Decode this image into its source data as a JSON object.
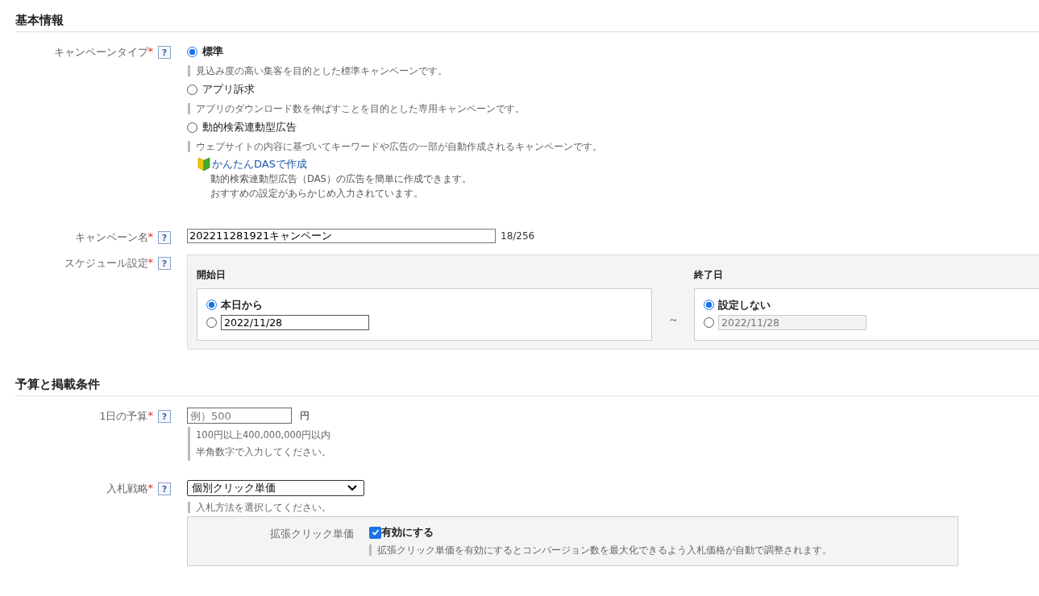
{
  "sections": [
    {
      "title": "基本情報",
      "fields": [
        {
          "kind": "radio_group",
          "label": "キャンペーンタイプ",
          "mark": "*",
          "help": "?",
          "options": [
            {
              "label": "標準",
              "selected": true,
              "hint": "見込み度の高い集客を目的とした標準キャンペーンです。"
            },
            {
              "label": "アプリ訴求",
              "selected": false,
              "hint": "アプリのダウンロード数を伸ばすことを目的とした専用キャンペーンです。"
            },
            {
              "label": "動的検索連動型広告",
              "selected": false,
              "hint": "ウェブサイトの内容に基づいてキーワードや広告の一部が自動作成されるキャンペーンです。",
              "link": "かんたんDASで作成",
              "notes": [
                "動的検索連動型広告（DAS）の広告を簡単に作成できます。",
                "おすすめの設定があらかじめ入力されています。"
              ]
            }
          ]
        },
        {
          "kind": "text",
          "label": "キャンペーン名",
          "mark": "*",
          "help": "?",
          "value": "202211281921キャンペーン",
          "count": "18/256"
        },
        {
          "kind": "schedule",
          "label": "スケジュール設定",
          "mark": "*",
          "help": "?",
          "separator": "～",
          "groups": [
            {
              "title": "開始日",
              "options": [
                {
                  "kind": "label",
                  "label": "本日から",
                  "selected": true
                },
                {
                  "kind": "date",
                  "value": "2022/11/28",
                  "selected": false,
                  "disabled": false
                }
              ]
            },
            {
              "title": "終了日",
              "options": [
                {
                  "kind": "label",
                  "label": "設定しない",
                  "selected": true
                },
                {
                  "kind": "date",
                  "value": "2022/11/28",
                  "selected": false,
                  "disabled": true
                }
              ]
            }
          ]
        }
      ]
    },
    {
      "title": "予算と掲載条件",
      "fields": [
        {
          "kind": "amount",
          "label": "1日の予算",
          "mark": "*",
          "help": "?",
          "placeholder": "例）500",
          "unit": "円",
          "hints": [
            "100円以上400,000,000円以内",
            "半角数字で入力してください。"
          ]
        },
        {
          "kind": "select",
          "label": "入札戦略",
          "mark": "*",
          "help": "?",
          "value": "個別クリック単価",
          "hint": "入札方法を選択してください。",
          "sub": {
            "label": "拡張クリック単価",
            "checkbox": {
              "label": "有効にする",
              "checked": true
            },
            "hint": "拡張クリック単価を有効にするとコンバージョン数を最大化できるよう入札価格が自動で調整されます。"
          }
        }
      ]
    }
  ]
}
